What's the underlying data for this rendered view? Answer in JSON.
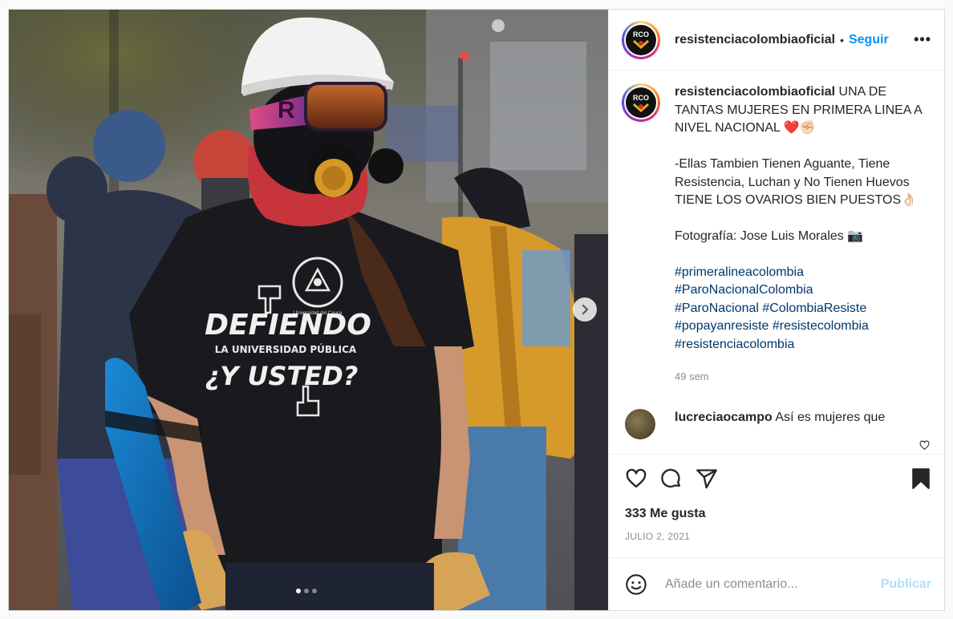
{
  "post": {
    "username": "resistenciacolombiaoficial",
    "follow_label": "Seguir",
    "separator": "•",
    "more_label": "•••",
    "avatar_text": "RCO",
    "caption": "UNA DE TANTAS MUJERES EN PRIMERA LINEA A NIVEL NACIONAL ❤️✊🏻\n\n-Ellas Tambien Tienen Aguante, Tiene Resistencia, Luchan y No Tienen Huevos TIENE LOS OVARIOS BIEN PUESTOS👌🏻\n\nFotografía: Jose Luis Morales 📷",
    "hashtags": {
      "h1": "#primeralineacolombia",
      "h2": "#ParoNacionalColombia",
      "h3a": "#ParoNacional",
      "h3b": "#ColombiaResiste",
      "h4a": "#popayanresiste",
      "h4b": "#resistecolombia",
      "h5": "#resistenciacolombia"
    },
    "time_ago": "49 sem",
    "comment": {
      "username": "lucreciaocampo",
      "text": "Así es mujeres que"
    },
    "likes": "333 Me gusta",
    "date": "JULIO 2, 2021",
    "add_comment_placeholder": "Añade un comentario...",
    "publish_label": "Publicar"
  },
  "photo": {
    "shirt_line1": "DEFIENDO",
    "shirt_line2": "LA UNIVERSIDAD PÚBLICA",
    "shirt_line3": "¿Y USTED?",
    "shirt_logo_text": "Universidad del Cauca",
    "goggle_text": "R",
    "carousel": {
      "count": 3,
      "active": 1
    }
  },
  "colors": {
    "link": "#00376b",
    "follow": "#0095f6",
    "publish_disabled": "#b2dffc",
    "muted": "#8e8e8e"
  }
}
